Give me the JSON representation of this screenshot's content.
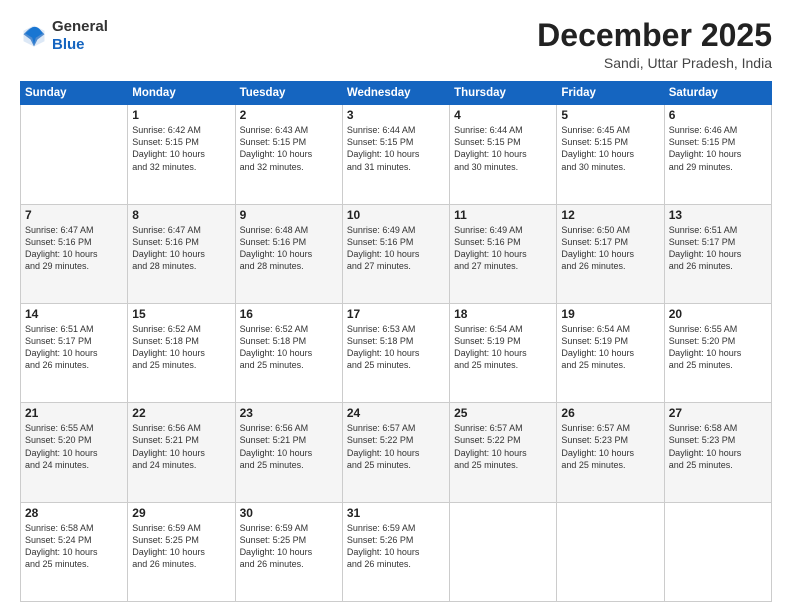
{
  "header": {
    "logo_general": "General",
    "logo_blue": "Blue",
    "month_title": "December 2025",
    "location": "Sandi, Uttar Pradesh, India"
  },
  "days_of_week": [
    "Sunday",
    "Monday",
    "Tuesday",
    "Wednesday",
    "Thursday",
    "Friday",
    "Saturday"
  ],
  "weeks": [
    [
      {
        "day": "",
        "info": ""
      },
      {
        "day": "1",
        "info": "Sunrise: 6:42 AM\nSunset: 5:15 PM\nDaylight: 10 hours\nand 32 minutes."
      },
      {
        "day": "2",
        "info": "Sunrise: 6:43 AM\nSunset: 5:15 PM\nDaylight: 10 hours\nand 32 minutes."
      },
      {
        "day": "3",
        "info": "Sunrise: 6:44 AM\nSunset: 5:15 PM\nDaylight: 10 hours\nand 31 minutes."
      },
      {
        "day": "4",
        "info": "Sunrise: 6:44 AM\nSunset: 5:15 PM\nDaylight: 10 hours\nand 30 minutes."
      },
      {
        "day": "5",
        "info": "Sunrise: 6:45 AM\nSunset: 5:15 PM\nDaylight: 10 hours\nand 30 minutes."
      },
      {
        "day": "6",
        "info": "Sunrise: 6:46 AM\nSunset: 5:15 PM\nDaylight: 10 hours\nand 29 minutes."
      }
    ],
    [
      {
        "day": "7",
        "info": "Sunrise: 6:47 AM\nSunset: 5:16 PM\nDaylight: 10 hours\nand 29 minutes."
      },
      {
        "day": "8",
        "info": "Sunrise: 6:47 AM\nSunset: 5:16 PM\nDaylight: 10 hours\nand 28 minutes."
      },
      {
        "day": "9",
        "info": "Sunrise: 6:48 AM\nSunset: 5:16 PM\nDaylight: 10 hours\nand 28 minutes."
      },
      {
        "day": "10",
        "info": "Sunrise: 6:49 AM\nSunset: 5:16 PM\nDaylight: 10 hours\nand 27 minutes."
      },
      {
        "day": "11",
        "info": "Sunrise: 6:49 AM\nSunset: 5:16 PM\nDaylight: 10 hours\nand 27 minutes."
      },
      {
        "day": "12",
        "info": "Sunrise: 6:50 AM\nSunset: 5:17 PM\nDaylight: 10 hours\nand 26 minutes."
      },
      {
        "day": "13",
        "info": "Sunrise: 6:51 AM\nSunset: 5:17 PM\nDaylight: 10 hours\nand 26 minutes."
      }
    ],
    [
      {
        "day": "14",
        "info": "Sunrise: 6:51 AM\nSunset: 5:17 PM\nDaylight: 10 hours\nand 26 minutes."
      },
      {
        "day": "15",
        "info": "Sunrise: 6:52 AM\nSunset: 5:18 PM\nDaylight: 10 hours\nand 25 minutes."
      },
      {
        "day": "16",
        "info": "Sunrise: 6:52 AM\nSunset: 5:18 PM\nDaylight: 10 hours\nand 25 minutes."
      },
      {
        "day": "17",
        "info": "Sunrise: 6:53 AM\nSunset: 5:18 PM\nDaylight: 10 hours\nand 25 minutes."
      },
      {
        "day": "18",
        "info": "Sunrise: 6:54 AM\nSunset: 5:19 PM\nDaylight: 10 hours\nand 25 minutes."
      },
      {
        "day": "19",
        "info": "Sunrise: 6:54 AM\nSunset: 5:19 PM\nDaylight: 10 hours\nand 25 minutes."
      },
      {
        "day": "20",
        "info": "Sunrise: 6:55 AM\nSunset: 5:20 PM\nDaylight: 10 hours\nand 25 minutes."
      }
    ],
    [
      {
        "day": "21",
        "info": "Sunrise: 6:55 AM\nSunset: 5:20 PM\nDaylight: 10 hours\nand 24 minutes."
      },
      {
        "day": "22",
        "info": "Sunrise: 6:56 AM\nSunset: 5:21 PM\nDaylight: 10 hours\nand 24 minutes."
      },
      {
        "day": "23",
        "info": "Sunrise: 6:56 AM\nSunset: 5:21 PM\nDaylight: 10 hours\nand 25 minutes."
      },
      {
        "day": "24",
        "info": "Sunrise: 6:57 AM\nSunset: 5:22 PM\nDaylight: 10 hours\nand 25 minutes."
      },
      {
        "day": "25",
        "info": "Sunrise: 6:57 AM\nSunset: 5:22 PM\nDaylight: 10 hours\nand 25 minutes."
      },
      {
        "day": "26",
        "info": "Sunrise: 6:57 AM\nSunset: 5:23 PM\nDaylight: 10 hours\nand 25 minutes."
      },
      {
        "day": "27",
        "info": "Sunrise: 6:58 AM\nSunset: 5:23 PM\nDaylight: 10 hours\nand 25 minutes."
      }
    ],
    [
      {
        "day": "28",
        "info": "Sunrise: 6:58 AM\nSunset: 5:24 PM\nDaylight: 10 hours\nand 25 minutes."
      },
      {
        "day": "29",
        "info": "Sunrise: 6:59 AM\nSunset: 5:25 PM\nDaylight: 10 hours\nand 26 minutes."
      },
      {
        "day": "30",
        "info": "Sunrise: 6:59 AM\nSunset: 5:25 PM\nDaylight: 10 hours\nand 26 minutes."
      },
      {
        "day": "31",
        "info": "Sunrise: 6:59 AM\nSunset: 5:26 PM\nDaylight: 10 hours\nand 26 minutes."
      },
      {
        "day": "",
        "info": ""
      },
      {
        "day": "",
        "info": ""
      },
      {
        "day": "",
        "info": ""
      }
    ]
  ]
}
